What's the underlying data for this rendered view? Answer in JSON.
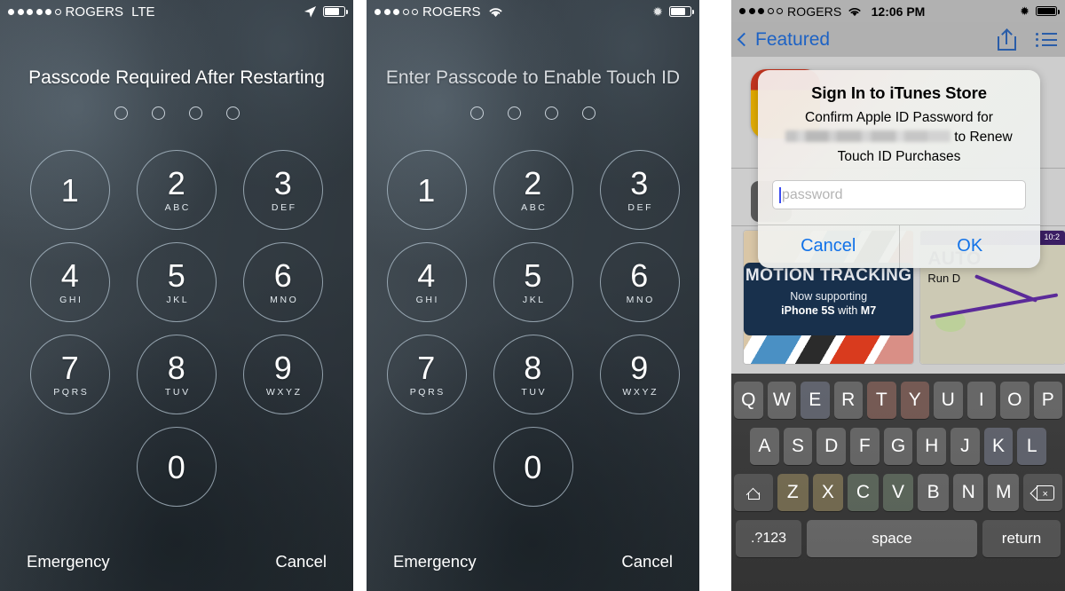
{
  "panel1": {
    "status": {
      "carrier": "ROGERS",
      "network": "LTE",
      "signal_filled": 5,
      "signal_total": 6,
      "icons": [
        "location-arrow-icon",
        "battery-icon"
      ]
    },
    "title": "Passcode Required After Restarting",
    "passcode_dots": 4,
    "keys": [
      {
        "num": "1",
        "letters": ""
      },
      {
        "num": "2",
        "letters": "ABC"
      },
      {
        "num": "3",
        "letters": "DEF"
      },
      {
        "num": "4",
        "letters": "GHI"
      },
      {
        "num": "5",
        "letters": "JKL"
      },
      {
        "num": "6",
        "letters": "MNO"
      },
      {
        "num": "7",
        "letters": "PQRS"
      },
      {
        "num": "8",
        "letters": "TUV"
      },
      {
        "num": "9",
        "letters": "WXYZ"
      },
      {
        "num": "0",
        "letters": ""
      }
    ],
    "emergency": "Emergency",
    "cancel": "Cancel"
  },
  "panel2": {
    "status": {
      "carrier": "ROGERS",
      "network": "",
      "signal_filled": 3,
      "signal_total": 5,
      "icons": [
        "wifi-icon",
        "bluetooth-icon",
        "battery-icon"
      ]
    },
    "title": "Enter Passcode to Enable Touch ID",
    "passcode_dots": 4,
    "keys": [
      {
        "num": "1",
        "letters": ""
      },
      {
        "num": "2",
        "letters": "ABC"
      },
      {
        "num": "3",
        "letters": "DEF"
      },
      {
        "num": "4",
        "letters": "GHI"
      },
      {
        "num": "5",
        "letters": "JKL"
      },
      {
        "num": "6",
        "letters": "MNO"
      },
      {
        "num": "7",
        "letters": "PQRS"
      },
      {
        "num": "8",
        "letters": "TUV"
      },
      {
        "num": "9",
        "letters": "WXYZ"
      },
      {
        "num": "0",
        "letters": ""
      }
    ],
    "emergency": "Emergency",
    "cancel": "Cancel"
  },
  "panel3": {
    "status": {
      "carrier": "ROGERS",
      "time": "12:06 PM",
      "signal_filled": 3,
      "signal_total": 5,
      "icons": [
        "wifi-icon",
        "bluetooth-icon",
        "battery-icon"
      ]
    },
    "nav": {
      "back_label": "Featured",
      "share_icon": "share-icon",
      "list_icon": "list-icon"
    },
    "dialog": {
      "title": "Sign In to iTunes Store",
      "message_line1": "Confirm Apple ID Password for",
      "message_redacted": "",
      "message_line2_tail": "to Renew",
      "message_line3": "Touch ID Purchases",
      "password_placeholder": "password",
      "password_value": "",
      "cancel_label": "Cancel",
      "ok_label": "OK"
    },
    "screenshots": [
      {
        "banner_title": "MOTION TRACKING",
        "banner_sub": "Now supporting",
        "banner_sub2_a": "iPhone 5S",
        "banner_sub2_b": " with ",
        "banner_sub2_c": "M7"
      },
      {
        "topbar_time": "10:2",
        "title": "AUTO",
        "subtitle": "Run D"
      }
    ],
    "keyboard": {
      "row1": [
        "Q",
        "W",
        "E",
        "R",
        "T",
        "Y",
        "U",
        "I",
        "O",
        "P"
      ],
      "row2": [
        "A",
        "S",
        "D",
        "F",
        "G",
        "H",
        "J",
        "K",
        "L"
      ],
      "row3": [
        "Z",
        "X",
        "C",
        "V",
        "B",
        "N",
        "M"
      ],
      "shift_icon": "shift-icon",
      "delete_icon": "delete-icon",
      "numbers_label": ".?123",
      "space_label": "space",
      "return_label": "return"
    }
  },
  "colors": {
    "lock_bg": "#3a444c",
    "accent_blue": "#1272e8",
    "nav_blue": "#1d62c4",
    "statusbar_grey": "#b1b1b1",
    "keyboard_bg": "#303030"
  }
}
